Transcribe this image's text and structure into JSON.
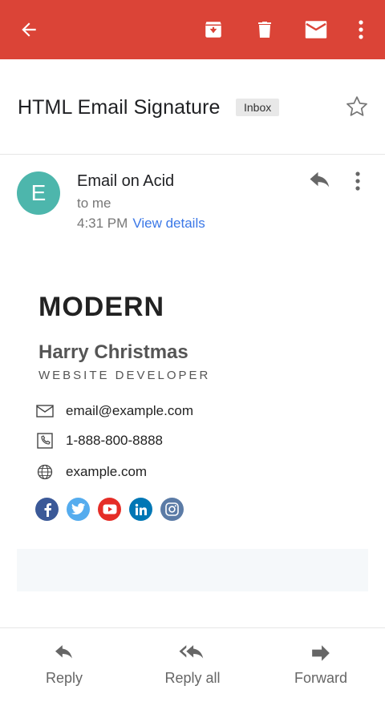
{
  "colors": {
    "appbar": "#db4437",
    "avatar": "#4db6ac",
    "link": "#3b78e7",
    "facebook": "#3b5998",
    "twitter": "#55acee",
    "youtube": "#e52d27",
    "linkedin": "#0077b5",
    "instagram": "#5b7ba6"
  },
  "toolbar": {
    "icons": [
      "back-arrow-icon",
      "archive-icon",
      "trash-icon",
      "mail-icon",
      "more-vert-icon"
    ]
  },
  "email": {
    "subject": "HTML Email Signature",
    "label": "Inbox",
    "sender": {
      "initial": "E",
      "name": "Email on Acid",
      "to": "to me",
      "time": "4:31 PM",
      "details_link": "View details"
    }
  },
  "signature": {
    "logo": "MODERN",
    "name": "Harry Christmas",
    "title": "WEBSITE DEVELOPER",
    "contacts": [
      {
        "icon": "envelope-icon",
        "value": "email@example.com"
      },
      {
        "icon": "phone-icon",
        "value": "1-888-800-8888"
      },
      {
        "icon": "globe-icon",
        "value": "example.com"
      }
    ],
    "socials": [
      "facebook-icon",
      "twitter-icon",
      "youtube-icon",
      "linkedin-icon",
      "instagram-icon"
    ]
  },
  "actions": {
    "reply": "Reply",
    "reply_all": "Reply all",
    "forward": "Forward"
  }
}
